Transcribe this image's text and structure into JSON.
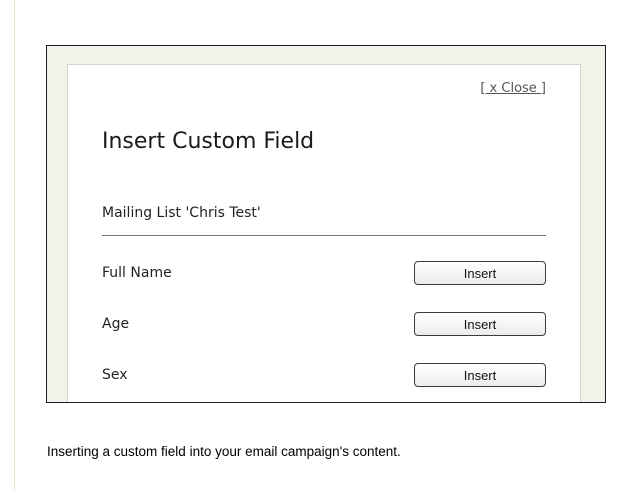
{
  "dialog": {
    "close_label": "[ x Close ]",
    "title": "Insert Custom Field",
    "list_label": "Mailing List 'Chris Test'",
    "fields": [
      {
        "label": "Full Name",
        "button": "Insert"
      },
      {
        "label": "Age",
        "button": "Insert"
      },
      {
        "label": "Sex",
        "button": "Insert"
      }
    ]
  },
  "caption": "Inserting a custom field into your email campaign's content."
}
